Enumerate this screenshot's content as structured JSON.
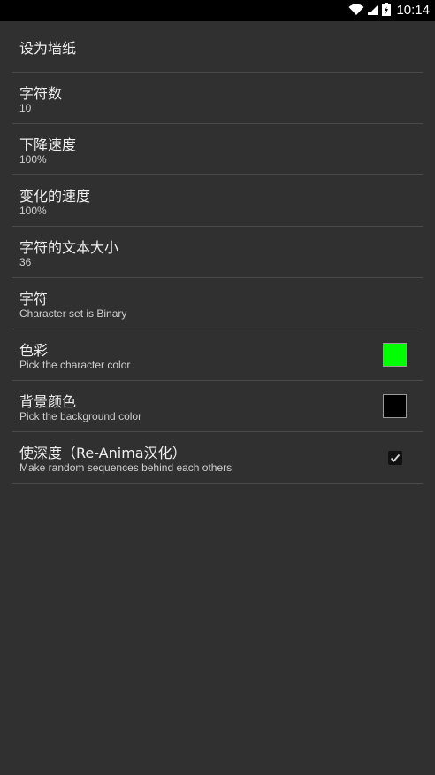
{
  "status_bar": {
    "time": "10:14",
    "icons": [
      "wifi-icon",
      "signal-icon",
      "battery-icon"
    ]
  },
  "preferences": [
    {
      "title": "设为墙纸",
      "summary": null
    },
    {
      "title": "字符数",
      "summary": "10"
    },
    {
      "title": "下降速度",
      "summary": "100%"
    },
    {
      "title": "变化的速度",
      "summary": "100%"
    },
    {
      "title": "字符的文本大小",
      "summary": "36"
    },
    {
      "title": "字符",
      "summary": "Character set is Binary"
    },
    {
      "title": "色彩",
      "summary": "Pick the character color",
      "swatch_color": "#00ff00"
    },
    {
      "title": "背景颜色",
      "summary": "Pick the background color",
      "swatch_color": "#000000"
    },
    {
      "title": "使深度（Re-Anima汉化）",
      "summary": "Make random sequences behind each others",
      "checked": true
    }
  ],
  "colors": {
    "background": "#303030",
    "divider": "#4a4a4a",
    "status_bar": "#000000"
  }
}
